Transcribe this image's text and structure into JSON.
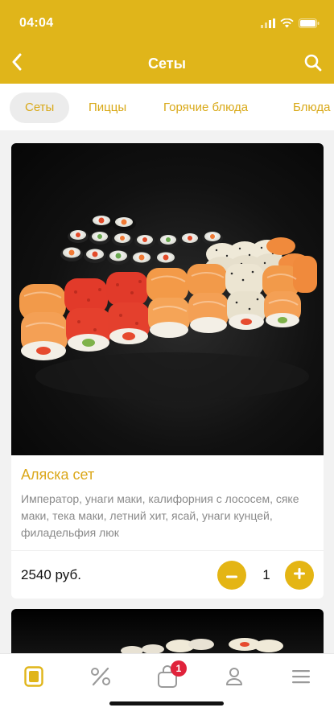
{
  "status_bar": {
    "time": "04:04"
  },
  "nav": {
    "title": "Сеты"
  },
  "tabs": [
    {
      "label": "Сеты",
      "active": true
    },
    {
      "label": "Пиццы",
      "active": false
    },
    {
      "label": "Горячие блюда",
      "active": false
    },
    {
      "label": "Блюда",
      "active": false
    }
  ],
  "products": [
    {
      "name": "Аляска сет",
      "description": "Император, унаги маки, калифорния с лососем, сяке маки, тека маки, летний хит, ясай, унаги кунцей, филадельфия люк",
      "price": "2540 руб.",
      "quantity": "1"
    }
  ],
  "cart": {
    "badge_count": "1"
  },
  "colors": {
    "accent": "#e0b51a",
    "badge": "#e0233b",
    "accent_text": "#dba81b"
  },
  "icons": {
    "back": "chevron-left-icon",
    "search": "search-icon",
    "minus": "minus-icon",
    "plus": "plus-icon",
    "bottom_nav": [
      "menu-card-icon",
      "percent-icon",
      "bag-icon",
      "profile-icon",
      "hamburger-icon"
    ]
  }
}
